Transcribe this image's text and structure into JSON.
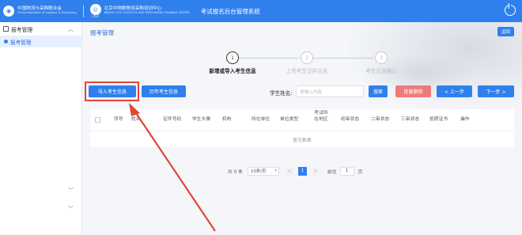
{
  "header": {
    "org1_name": "中国物流与采购联合会",
    "org1_sub": "China Federation of Logistics & Purchasing",
    "org1_mark": "CFLP",
    "org2_name": "北京中物联物流采购培训中心",
    "org2_sub": "BEIJING CFLP LOGISTICS AND PURCHASING TRAINING CENTER",
    "org2_mark": "CFLP",
    "app_title": "考试报名后台管理系统"
  },
  "sidebar": {
    "group": "报考管理",
    "active_item": "报考管理"
  },
  "main": {
    "title": "报考管理",
    "back_button": "返回"
  },
  "steps": [
    {
      "num": "1",
      "label": "新增或导入考生信息"
    },
    {
      "num": "2",
      "label": "上传考生证件信息"
    },
    {
      "num": "3",
      "label": "考生信息确认"
    }
  ],
  "toolbar": {
    "import_button": "导入考生信息",
    "history_button": "历年考生信息",
    "name_label": "学生姓名:",
    "name_placeholder": "请输入内容",
    "search_button": "搜索",
    "batch_delete_button": "批量删除",
    "prev_button": "< 上一步",
    "next_button": "下一步 >"
  },
  "table": {
    "columns": [
      "序号",
      "姓名",
      "证件号码",
      "学生头像",
      "机构",
      "所在单位",
      "单位类型",
      "考试所在地区",
      "初审状态",
      "二审状态",
      "三审状态",
      "抵质证书",
      "操作"
    ],
    "empty_text": "暂无数据"
  },
  "pagination": {
    "total_text": "共 0 条",
    "page_size": "10条/页",
    "prev": "<",
    "current_page": "1",
    "next": ">",
    "goto_label": "前往",
    "goto_value": "1",
    "page_unit": "页"
  },
  "colors": {
    "primary": "#2f80ed",
    "danger": "#f07a7a",
    "highlight": "#e0463a"
  }
}
